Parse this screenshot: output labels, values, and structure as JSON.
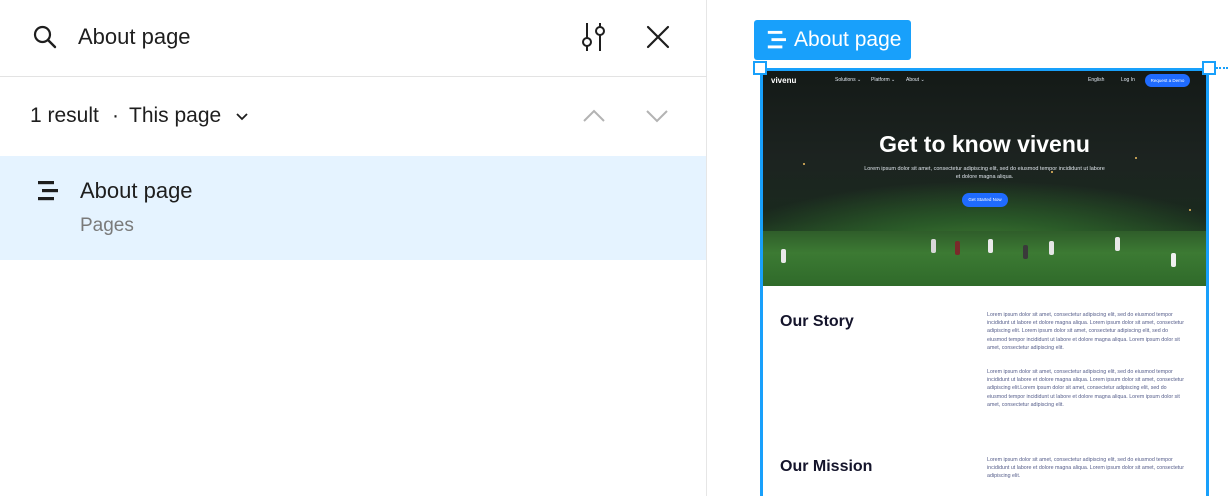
{
  "search": {
    "query": "About page",
    "icon": "search-icon",
    "filter_icon": "sliders-icon",
    "close_icon": "close-icon"
  },
  "results": {
    "count": "1 result",
    "separator": "·",
    "scope": "This page",
    "items": [
      {
        "title": "About page",
        "subtitle": "Pages",
        "icon": "page-frame-icon"
      }
    ]
  },
  "canvas": {
    "frame_label": "About page",
    "accent": "#18a0fb",
    "highlight": "#e5f3ff"
  },
  "preview": {
    "logo": "vivenu",
    "nav_links": [
      "Solutions ⌄",
      "Platform ⌄",
      "About ⌄"
    ],
    "language": "English",
    "login": "Log In",
    "cta": "Request a Demo",
    "hero_title": "Get to know vivenu",
    "hero_text": "Lorem ipsum dolor sit amet, consectetur adipiscing elit, sed do eiusmod tempor incididunt ut labore et dolore magna aliqua.",
    "hero_button": "Get Started Now",
    "story_heading": "Our Story",
    "story_p1": "Lorem ipsum dolor sit amet, consectetur adipiscing elit, sed do eiusmod tempor incididunt ut labore et dolore magna aliqua. Lorem ipsum dolor sit amet, consectetur adipiscing elit. Lorem ipsum dolor sit amet, consectetur adipiscing elit, sed do eiusmod tempor incididunt ut labore et dolore magna aliqua. Lorem ipsum dolor sit amet, consectetur adipiscing elit.",
    "story_p2": "Lorem ipsum dolor sit amet, consectetur adipiscing elit, sed do eiusmod tempor incididunt ut labore et dolore magna aliqua. Lorem ipsum dolor sit amet, consectetur adipiscing elit.Lorem ipsum dolor sit amet, consectetur adipiscing elit, sed do eiusmod tempor incididunt ut labore et dolore magna aliqua. Lorem ipsum dolor sit amet, consectetur adipiscing elit.",
    "mission_heading": "Our Mission",
    "mission_p1": "Lorem ipsum dolor sit amet, consectetur adipiscing elit, sed do eiusmod tempor incididunt ut labore et dolore magna aliqua. Lorem ipsum dolor sit amet, consectetur adipiscing elit."
  }
}
